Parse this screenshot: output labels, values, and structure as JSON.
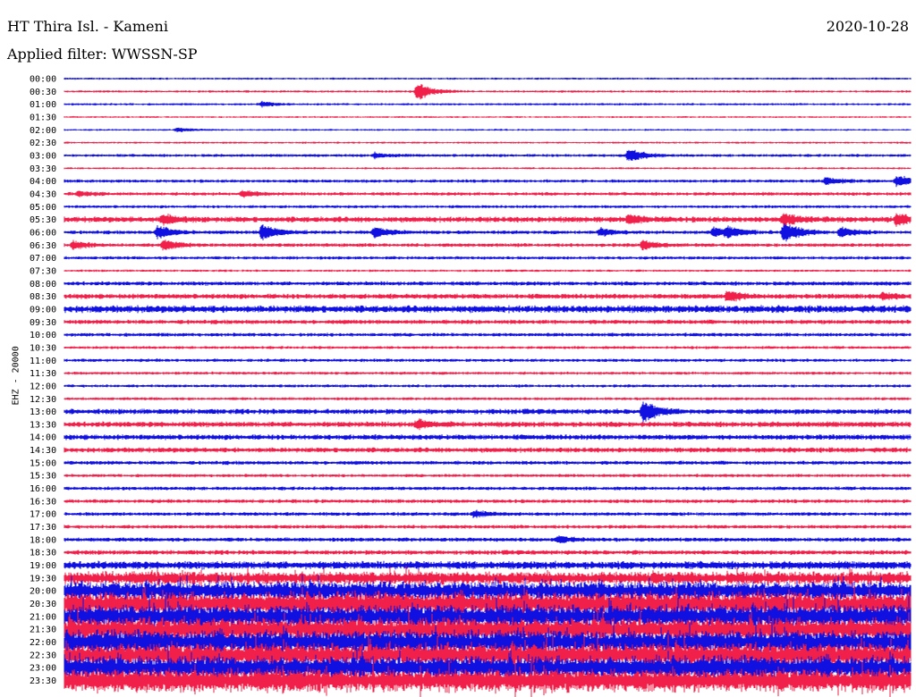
{
  "header": {
    "station": "HT Thira Isl. - Kameni",
    "date": "2020-10-28",
    "filter": "Applied filter: WWSSN-SP",
    "channel": "EHZ - 20000"
  },
  "colors": {
    "blue": "#1010e0",
    "red": "#f0204a"
  },
  "chart_data": {
    "type": "line",
    "title": "HT Thira Isl. - Kameni",
    "subtitle": "Applied filter: WWSSN-SP",
    "ylabel": "EHZ - 20000",
    "row_labels": [
      "00:00",
      "00:30",
      "01:00",
      "01:30",
      "02:00",
      "02:30",
      "03:00",
      "03:30",
      "04:00",
      "04:30",
      "05:00",
      "05:30",
      "06:00",
      "06:30",
      "07:00",
      "07:30",
      "08:00",
      "08:30",
      "09:00",
      "09:30",
      "10:00",
      "10:30",
      "11:00",
      "11:30",
      "12:00",
      "12:30",
      "13:00",
      "13:30",
      "14:00",
      "14:30",
      "15:00",
      "15:30",
      "16:00",
      "16:30",
      "17:00",
      "17:30",
      "18:00",
      "18:30",
      "19:00",
      "19:30",
      "20:00",
      "20:30",
      "21:00",
      "21:30",
      "22:00",
      "22:30",
      "23:00",
      "23:30"
    ],
    "trace_colors": [
      "blue",
      "red"
    ],
    "noise_level": [
      0.9,
      1.0,
      1.0,
      0.8,
      0.8,
      0.9,
      1.3,
      0.9,
      1.4,
      1.5,
      1.3,
      2.5,
      1.6,
      1.6,
      1.4,
      1.0,
      1.8,
      2.2,
      3.2,
      1.9,
      1.6,
      1.3,
      1.4,
      1.3,
      1.3,
      1.3,
      2.3,
      2.4,
      2.3,
      2.2,
      1.7,
      1.4,
      1.6,
      1.6,
      1.6,
      1.6,
      1.8,
      2.0,
      3.5,
      5.5,
      8,
      10,
      10,
      10,
      10,
      10,
      10,
      10
    ],
    "events": [
      {
        "row": 1,
        "minute": 12.5,
        "amplitude": 12
      },
      {
        "row": 2,
        "minute": 7,
        "amplitude": 3
      },
      {
        "row": 4,
        "minute": 4,
        "amplitude": 3
      },
      {
        "row": 6,
        "minute": 20,
        "amplitude": 9
      },
      {
        "row": 6,
        "minute": 11,
        "amplitude": 3
      },
      {
        "row": 8,
        "minute": 27,
        "amplitude": 5
      },
      {
        "row": 8,
        "minute": 29.5,
        "amplitude": 7
      },
      {
        "row": 9,
        "minute": 0.5,
        "amplitude": 3
      },
      {
        "row": 9,
        "minute": 6.3,
        "amplitude": 4
      },
      {
        "row": 11,
        "minute": 3.5,
        "amplitude": 6
      },
      {
        "row": 11,
        "minute": 20,
        "amplitude": 5
      },
      {
        "row": 11,
        "minute": 25.5,
        "amplitude": 7
      },
      {
        "row": 11,
        "minute": 29.5,
        "amplitude": 8
      },
      {
        "row": 12,
        "minute": 3.3,
        "amplitude": 9
      },
      {
        "row": 12,
        "minute": 7,
        "amplitude": 11
      },
      {
        "row": 12,
        "minute": 11,
        "amplitude": 7
      },
      {
        "row": 12,
        "minute": 19,
        "amplitude": 5
      },
      {
        "row": 12,
        "minute": 23,
        "amplitude": 6
      },
      {
        "row": 12,
        "minute": 23.5,
        "amplitude": 6
      },
      {
        "row": 12,
        "minute": 25.5,
        "amplitude": 14
      },
      {
        "row": 12,
        "minute": 27.5,
        "amplitude": 6
      },
      {
        "row": 13,
        "minute": 0.3,
        "amplitude": 5
      },
      {
        "row": 13,
        "minute": 3.5,
        "amplitude": 7
      },
      {
        "row": 13,
        "minute": 20.5,
        "amplitude": 6
      },
      {
        "row": 17,
        "minute": 23.5,
        "amplitude": 7
      },
      {
        "row": 17,
        "minute": 29,
        "amplitude": 3
      },
      {
        "row": 26,
        "minute": 20.5,
        "amplitude": 13
      },
      {
        "row": 27,
        "minute": 12.5,
        "amplitude": 5
      },
      {
        "row": 34,
        "minute": 14.5,
        "amplitude": 4
      },
      {
        "row": 36,
        "minute": 17.5,
        "amplitude": 4
      }
    ]
  }
}
